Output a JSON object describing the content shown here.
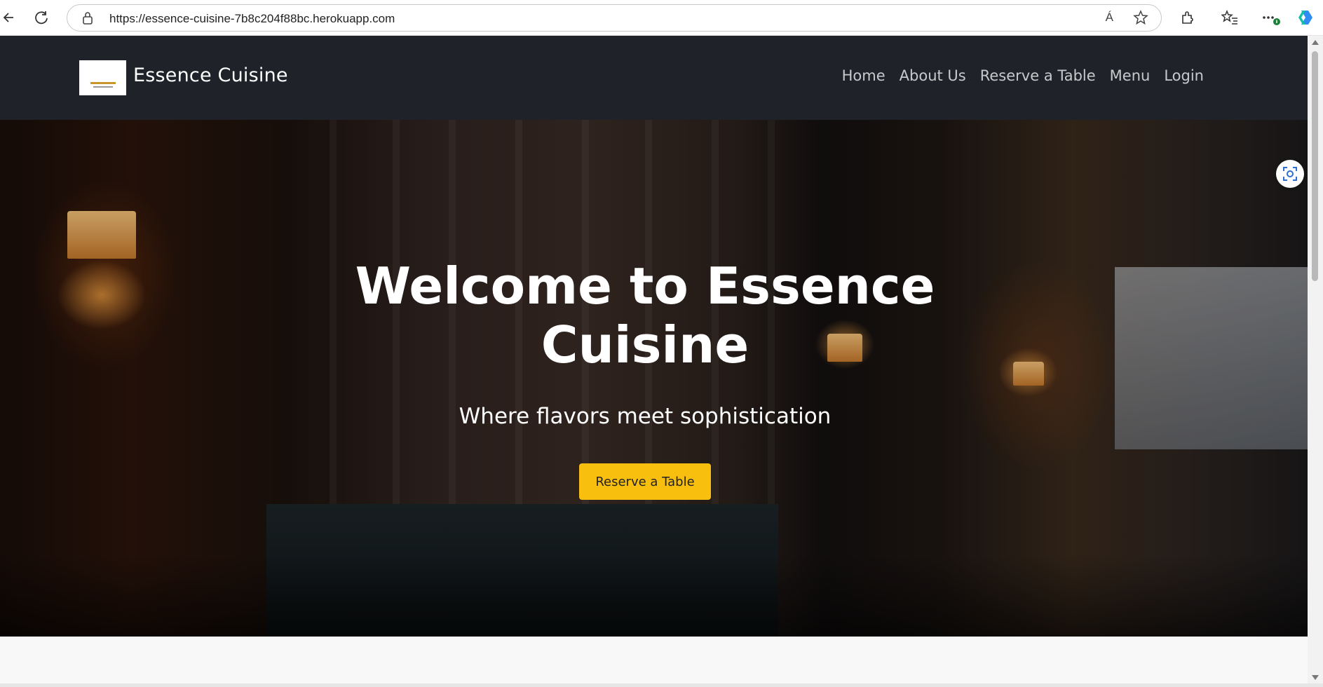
{
  "browser": {
    "url": "https://essence-cuisine-7b8c204f88bc.herokuapp.com",
    "read_aloud_label": "Á"
  },
  "site": {
    "brand_name": "Essence Cuisine",
    "nav_items": [
      "Home",
      "About Us",
      "Reserve a Table",
      "Menu",
      "Login"
    ]
  },
  "hero": {
    "title": "Welcome to Essence Cuisine",
    "subtitle": "Where flavors meet sophistication",
    "cta_label": "Reserve a Table"
  },
  "colors": {
    "navbar_bg": "#1f2329",
    "cta_bg": "#f8bf0e",
    "nav_text": "#c8c9cc"
  }
}
